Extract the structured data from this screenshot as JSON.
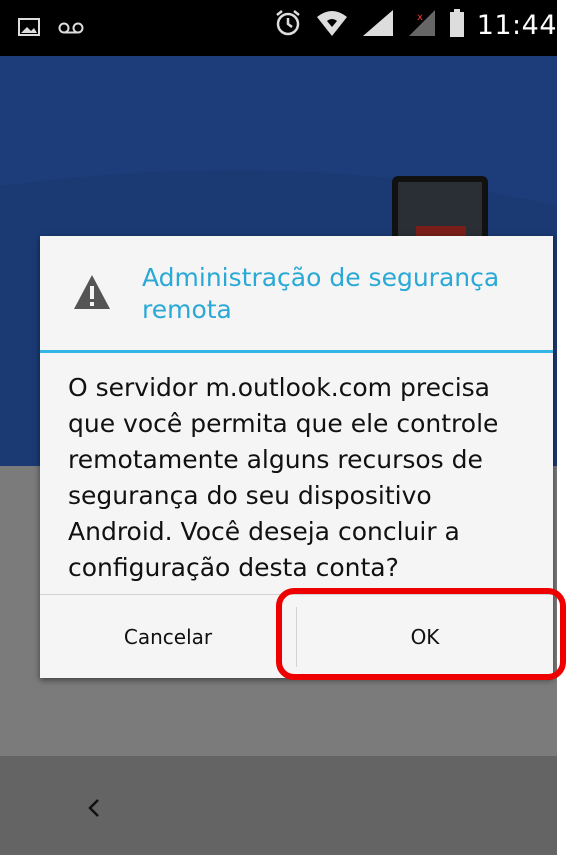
{
  "status_bar": {
    "time": "11:44",
    "icons": [
      "image-icon",
      "voicemail-icon",
      "alarm-icon",
      "wifi-icon",
      "signal-icon",
      "signal-no-service-icon",
      "battery-icon"
    ]
  },
  "dialog": {
    "title": "Administração de segurança remota",
    "icon": "warning-icon",
    "message": "O servidor m.outlook.com precisa que você permita que ele controle remotamente alguns recursos de segurança do seu dispositivo Android. Você deseja concluir a configuração desta conta?",
    "buttons": {
      "cancel_label": "Cancelar",
      "ok_label": "OK"
    }
  },
  "navigation": {
    "back_icon": "back-chevron-icon"
  },
  "colors": {
    "accent": "#33b5e5",
    "title": "#2aa9d6",
    "highlight": "#ee0000",
    "app_header": "#1d3d7a"
  }
}
